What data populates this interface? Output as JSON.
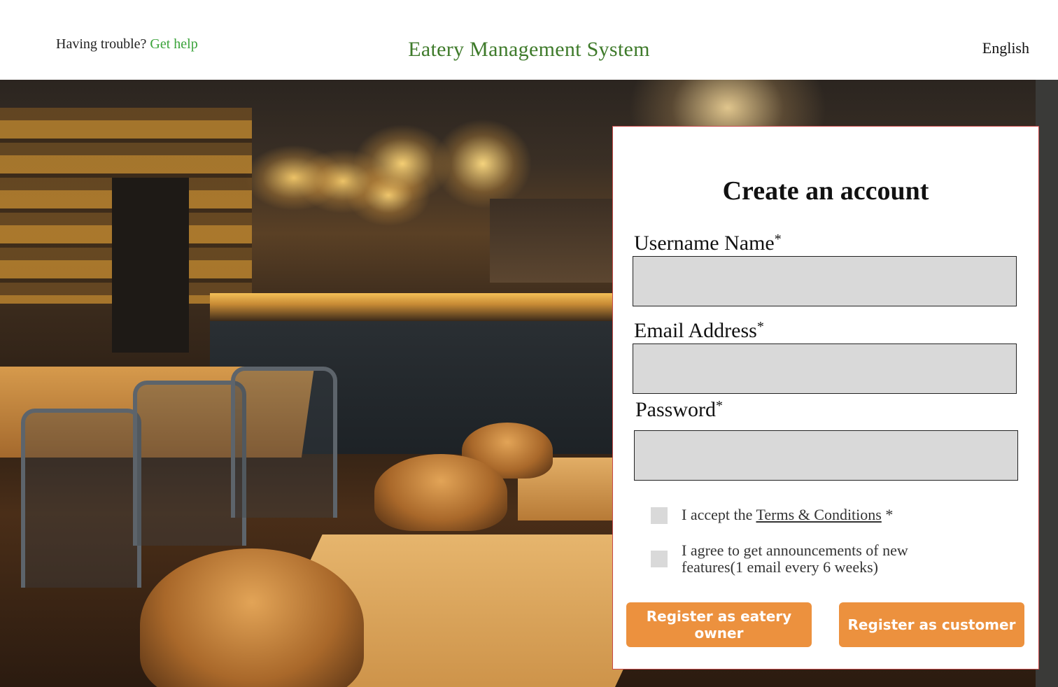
{
  "header": {
    "help_prompt": "Having trouble?",
    "help_link": "Get help",
    "title": "Eatery Management System",
    "language": "English"
  },
  "form": {
    "title": "Create an account",
    "fields": [
      {
        "label": "Username Name",
        "required_mark": "*",
        "value": ""
      },
      {
        "label": "Email Address",
        "required_mark": "*",
        "value": ""
      },
      {
        "label": "Password",
        "required_mark": "*",
        "value": ""
      }
    ],
    "terms": {
      "prefix": "I accept the ",
      "link": "Terms & Conditions",
      "suffix": " *",
      "checked": false
    },
    "announcements": {
      "line1": "I agree to get announcements of new",
      "line2": "features(1 email every 6 weeks)",
      "checked": false
    },
    "buttons": {
      "owner": "Register as eatery owner",
      "customer": "Register as customer"
    }
  },
  "colors": {
    "title_green": "#3e7a2a",
    "link_green": "#3aa33a",
    "button_orange": "#ec913e",
    "input_gray": "#d9d9d9",
    "card_border": "#c94a4a"
  }
}
